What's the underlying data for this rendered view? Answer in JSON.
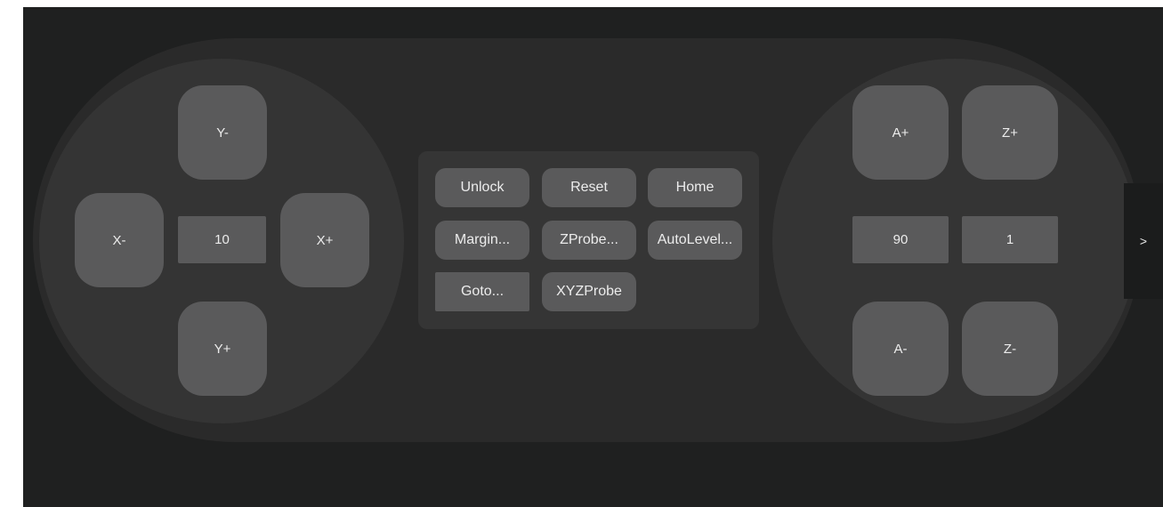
{
  "colors": {
    "background": "#1f2020",
    "panel": "#2a2a2a",
    "pad": "#343434",
    "button": "#5a5a5b",
    "text": "#ececec"
  },
  "left_pad": {
    "y_minus": "Y-",
    "y_plus": "Y+",
    "x_minus": "X-",
    "x_plus": "X+",
    "step_value": "10"
  },
  "right_pad": {
    "a_plus": "A+",
    "a_minus": "A-",
    "z_plus": "Z+",
    "z_minus": "Z-",
    "a_step_value": "90",
    "z_step_value": "1"
  },
  "commands": {
    "unlock": "Unlock",
    "reset": "Reset",
    "home": "Home",
    "margin": "Margin...",
    "zprobe": "ZProbe...",
    "autolevel": "AutoLevel...",
    "goto": "Goto...",
    "xyzprobe": "XYZProbe"
  },
  "side_tab": {
    "label": ">"
  }
}
